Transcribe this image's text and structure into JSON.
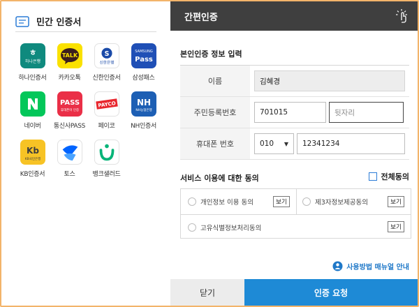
{
  "left": {
    "title": "민간 인증서",
    "apps": [
      {
        "icon": "hana-bank-icon",
        "label": "하나인증서",
        "bg": "#0f8a7e",
        "glyph": "하나은행"
      },
      {
        "icon": "kakaotalk-icon",
        "label": "카카오톡",
        "bg": "#fae100",
        "glyph": "TALK"
      },
      {
        "icon": "shinhan-bank-icon",
        "label": "신한인증서",
        "bg": "#ffffff",
        "glyph": "신한은행"
      },
      {
        "icon": "samsung-pass-icon",
        "label": "삼성패스",
        "bg": "#1f4fb6",
        "glyph": "Pass",
        "sub": "SAMSUNG"
      },
      {
        "icon": "naver-icon",
        "label": "네이버",
        "bg": "#03c75a",
        "glyph": "N"
      },
      {
        "icon": "pass-icon",
        "label": "통신사PASS",
        "bg": "#ea2f47",
        "glyph": "PASS",
        "sub": "휴대폰이 인증"
      },
      {
        "icon": "payco-icon",
        "label": "페이코",
        "bg": "#ffffff",
        "glyph": "PAYCO"
      },
      {
        "icon": "nh-icon",
        "label": "NH인증서",
        "bg": "#1d5fb4",
        "glyph": "NH",
        "sub": "NH농협은행"
      },
      {
        "icon": "kb-bank-icon",
        "label": "KB인증서",
        "bg": "#f7c325",
        "glyph": "Kb",
        "sub": "KB국민은행"
      },
      {
        "icon": "toss-icon",
        "label": "토스",
        "bg": "#ffffff",
        "glyph": ""
      },
      {
        "icon": "banksalad-icon",
        "label": "뱅크샐러드",
        "bg": "#ffffff",
        "glyph": ""
      }
    ]
  },
  "header": {
    "title": "간편인증"
  },
  "form": {
    "section_title": "본인인증 정보 입력",
    "name_label": "이름",
    "name_value": "김혜경",
    "rrn_label": "주민등록번호",
    "rrn_front": "701015",
    "rrn_back_placeholder": "뒷자리",
    "phone_label": "휴대폰 번호",
    "phone_carrier": "010",
    "phone_number": "12341234"
  },
  "consent": {
    "title": "서비스 이용에 대한 동의",
    "select_all": "전체동의",
    "items": [
      {
        "label": "개인정보 이용 동의",
        "view": "보기"
      },
      {
        "label": "제3자정보제공동의",
        "view": "보기"
      },
      {
        "label": "고유식별정보처리동의",
        "view": "보기"
      }
    ]
  },
  "manual_link": "사용방법 매뉴얼 안내",
  "buttons": {
    "close": "닫기",
    "request": "인증 요청"
  },
  "colors": {
    "accent": "#1e8ad6",
    "header_bg": "#3f3f3f",
    "frame": "#f3b46a"
  }
}
